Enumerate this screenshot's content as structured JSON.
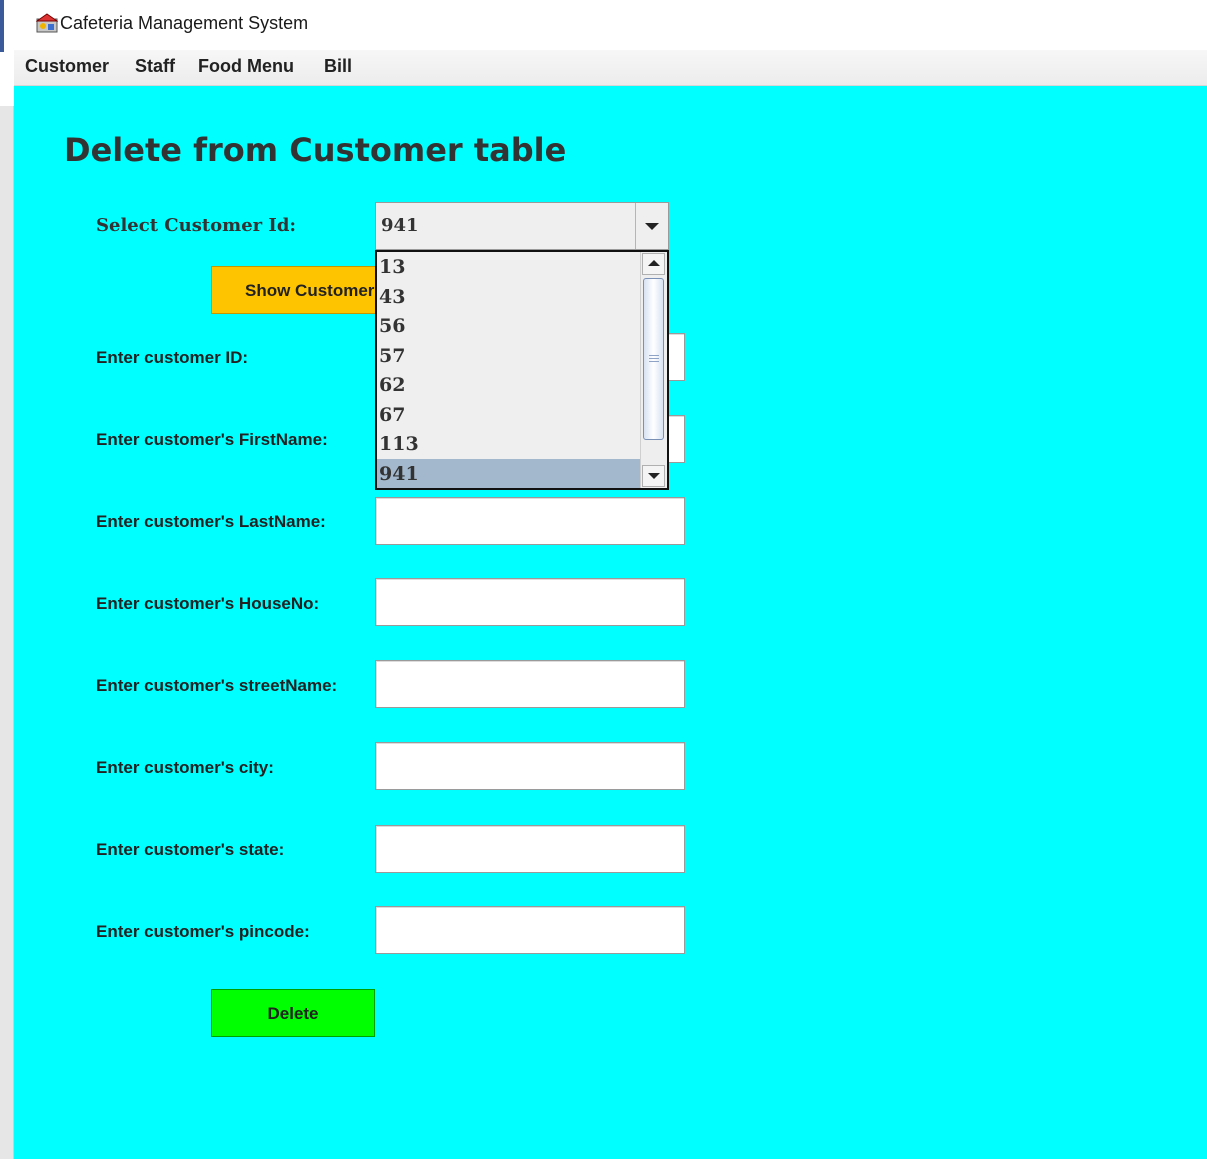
{
  "window": {
    "title": "Cafeteria Management System"
  },
  "menubar": {
    "items": [
      "Customer",
      "Staff",
      "Food Menu",
      "Bill"
    ]
  },
  "form": {
    "heading": "Delete from Customer table",
    "select_label": "Select Customer Id:",
    "selected_id": "941",
    "options": [
      "13",
      "43",
      "56",
      "57",
      "62",
      "67",
      "113",
      "941"
    ],
    "show_button": "Show Customer",
    "fields": [
      {
        "label": "Enter customer ID:",
        "value": ""
      },
      {
        "label": "Enter customer's FirstName:",
        "value": ""
      },
      {
        "label": "Enter customer's LastName:",
        "value": ""
      },
      {
        "label": "Enter customer's HouseNo:",
        "value": ""
      },
      {
        "label": "Enter customer's streetName:",
        "value": ""
      },
      {
        "label": "Enter customer's city:",
        "value": ""
      },
      {
        "label": "Enter customer's state:",
        "value": ""
      },
      {
        "label": "Enter customer's pincode:",
        "value": ""
      }
    ],
    "delete_button": "Delete"
  },
  "colors": {
    "background": "#00ffff",
    "show_button": "#ffc400",
    "delete_button": "#00ff00",
    "selected_option": "#a3b8cc"
  }
}
